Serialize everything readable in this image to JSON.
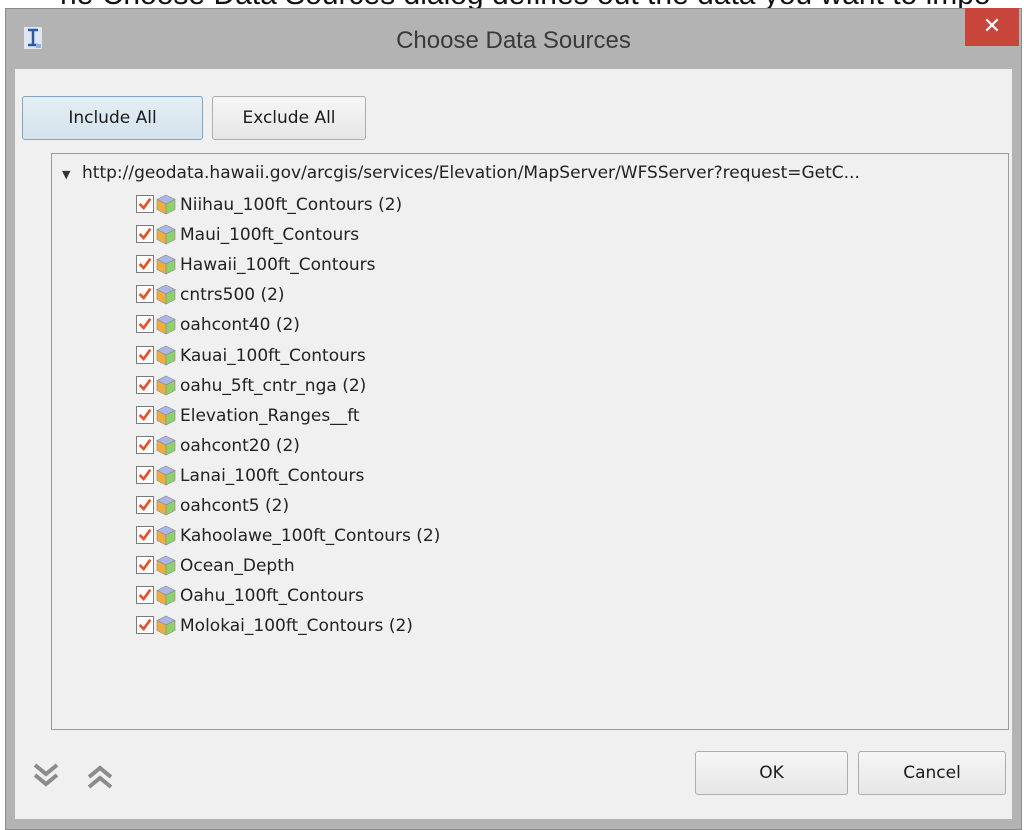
{
  "background_caption": "he Choose Data Sources dialog defines out the data you want to impo",
  "window": {
    "title": "Choose Data Sources",
    "close_glyph": "✕"
  },
  "toolbar": {
    "include_all": "Include All",
    "exclude_all": "Exclude All"
  },
  "tree": {
    "root_url": "http://geodata.hawaii.gov/arcgis/services/Elevation/MapServer/WFSServer?request=GetC...",
    "root_expanded": true,
    "items": [
      {
        "label": "Niihau_100ft_Contours (2)",
        "checked": true
      },
      {
        "label": "Maui_100ft_Contours",
        "checked": true
      },
      {
        "label": "Hawaii_100ft_Contours",
        "checked": true
      },
      {
        "label": "cntrs500 (2)",
        "checked": true
      },
      {
        "label": "oahcont40 (2)",
        "checked": true
      },
      {
        "label": "Kauai_100ft_Contours",
        "checked": true
      },
      {
        "label": "oahu_5ft_cntr_nga (2)",
        "checked": true
      },
      {
        "label": "Elevation_Ranges__ft",
        "checked": true
      },
      {
        "label": "oahcont20 (2)",
        "checked": true
      },
      {
        "label": "Lanai_100ft_Contours",
        "checked": true
      },
      {
        "label": "oahcont5 (2)",
        "checked": true
      },
      {
        "label": "Kahoolawe_100ft_Contours (2)",
        "checked": true
      },
      {
        "label": "Ocean_Depth",
        "checked": true
      },
      {
        "label": "Oahu_100ft_Contours",
        "checked": true
      },
      {
        "label": "Molokai_100ft_Contours (2)",
        "checked": true
      }
    ]
  },
  "footer": {
    "expand_all_icon": "double-chevron-down-icon",
    "collapse_all_icon": "double-chevron-up-icon",
    "ok": "OK",
    "cancel": "Cancel"
  },
  "colors": {
    "checkmark": "#e8502a",
    "close_button": "#c7453a",
    "dialog_frame": "#b3b3b3"
  }
}
